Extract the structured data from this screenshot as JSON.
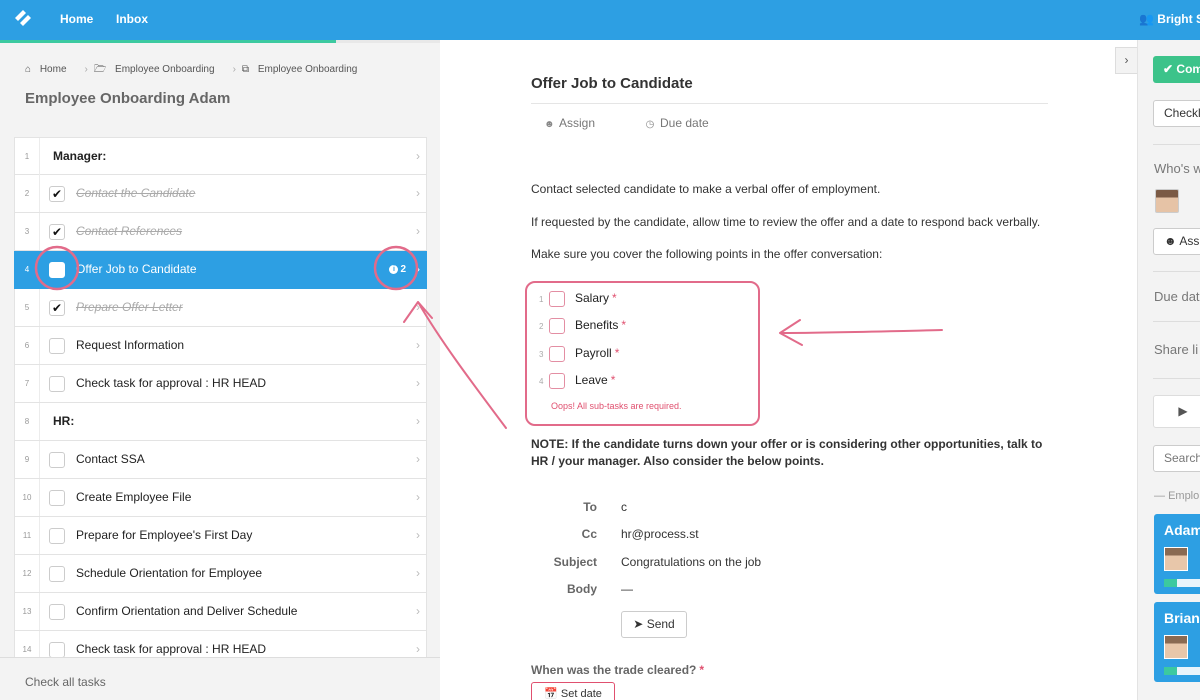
{
  "topbar": {
    "nav": [
      "Home",
      "Inbox"
    ],
    "org": "Bright St",
    "progress_fraction": 0.28
  },
  "breadcrumb": [
    "Home",
    "Employee Onboarding",
    "Employee Onboarding"
  ],
  "checklist": {
    "title": "Employee Onboarding Adam",
    "tasks": [
      {
        "num": "1",
        "label": "Manager:",
        "type": "header"
      },
      {
        "num": "2",
        "label": "Contact the Candidate",
        "type": "done"
      },
      {
        "num": "3",
        "label": "Contact References",
        "type": "done"
      },
      {
        "num": "4",
        "label": "Offer Job to Candidate",
        "type": "active",
        "badge": "2"
      },
      {
        "num": "5",
        "label": "Prepare Offer Letter",
        "type": "done"
      },
      {
        "num": "6",
        "label": "Request Information",
        "type": "todo"
      },
      {
        "num": "7",
        "label": "Check task for approval : HR HEAD",
        "type": "todo"
      },
      {
        "num": "8",
        "label": "HR:",
        "type": "header"
      },
      {
        "num": "9",
        "label": "Contact SSA",
        "type": "todo"
      },
      {
        "num": "10",
        "label": "Create Employee File",
        "type": "todo"
      },
      {
        "num": "11",
        "label": "Prepare for Employee's First Day",
        "type": "todo"
      },
      {
        "num": "12",
        "label": "Schedule Orientation for Employee",
        "type": "todo"
      },
      {
        "num": "13",
        "label": "Confirm Orientation and Deliver Schedule",
        "type": "todo"
      },
      {
        "num": "14",
        "label": "Check task for approval : HR HEAD",
        "type": "todo"
      }
    ],
    "check_all": "Check all tasks"
  },
  "task": {
    "title": "Offer Job to Candidate",
    "assign": "Assign",
    "due_date": "Due date",
    "paragraphs": [
      "Contact selected candidate to make a verbal offer of employment.",
      "If requested by the candidate, allow time to review the offer and a date to respond back verbally.",
      "Make sure you cover the following points in the offer conversation:"
    ],
    "subtasks": [
      {
        "num": "1",
        "label": "Salary"
      },
      {
        "num": "2",
        "label": "Benefits"
      },
      {
        "num": "3",
        "label": "Payroll"
      },
      {
        "num": "4",
        "label": "Leave"
      }
    ],
    "required_mark": "*",
    "subtask_error": "Oops! All sub-tasks are required.",
    "note": "NOTE: If the candidate turns down your offer or is considering other opportunities, talk to HR / your manager. Also consider the below points.",
    "email": {
      "to_label": "To",
      "to": "c",
      "cc_label": "Cc",
      "cc": "hr@process.st",
      "subject_label": "Subject",
      "subject": "Congratulations on the job",
      "body_label": "Body",
      "body": "—",
      "send": "Send"
    },
    "question": "When was the trade cleared?",
    "set_date": "Set date"
  },
  "sidebar": {
    "complete": "Com",
    "checklist_btn": "Checkl",
    "whos_working": "Who's w",
    "assign_btn": "Ass",
    "due_date": "Due dat",
    "share_link": "Share li",
    "search": "Search",
    "section": "Emplo",
    "cards": [
      {
        "name": "Adam",
        "progress": 0.25
      },
      {
        "name": "Brian",
        "progress": 0.25
      }
    ]
  },
  "colors": {
    "accent": "#2d9fe3",
    "success": "#3cc9a0",
    "error": "#e0506f"
  }
}
